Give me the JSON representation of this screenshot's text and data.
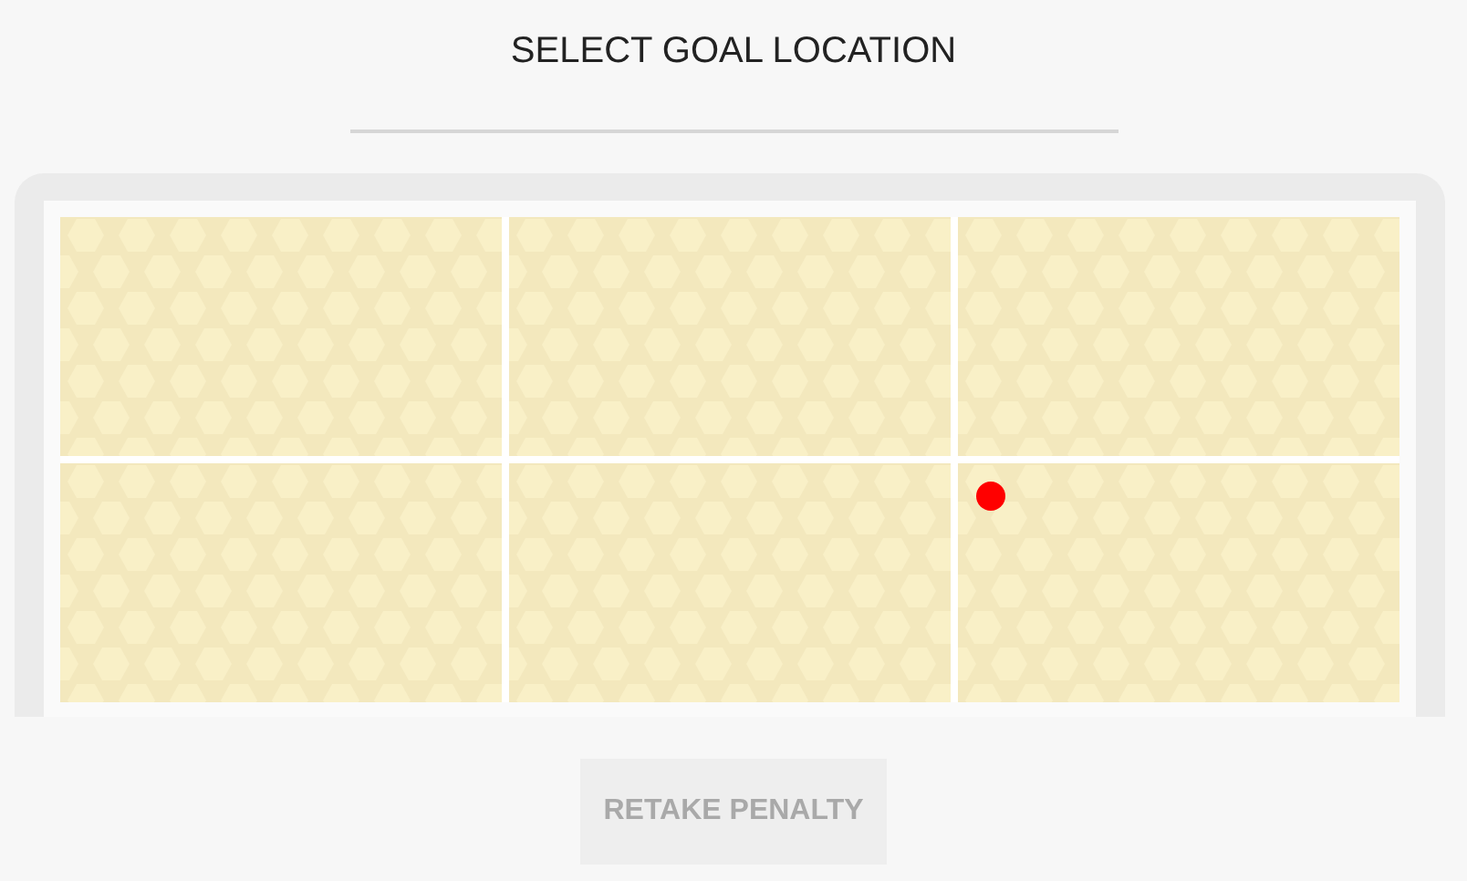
{
  "title": "SELECT GOAL LOCATION",
  "zones": [
    {
      "marker": false
    },
    {
      "marker": false
    },
    {
      "marker": false
    },
    {
      "marker": false
    },
    {
      "marker": false
    },
    {
      "marker": true
    }
  ],
  "button": {
    "label": "RETAKE PENALTY",
    "disabled": true
  }
}
